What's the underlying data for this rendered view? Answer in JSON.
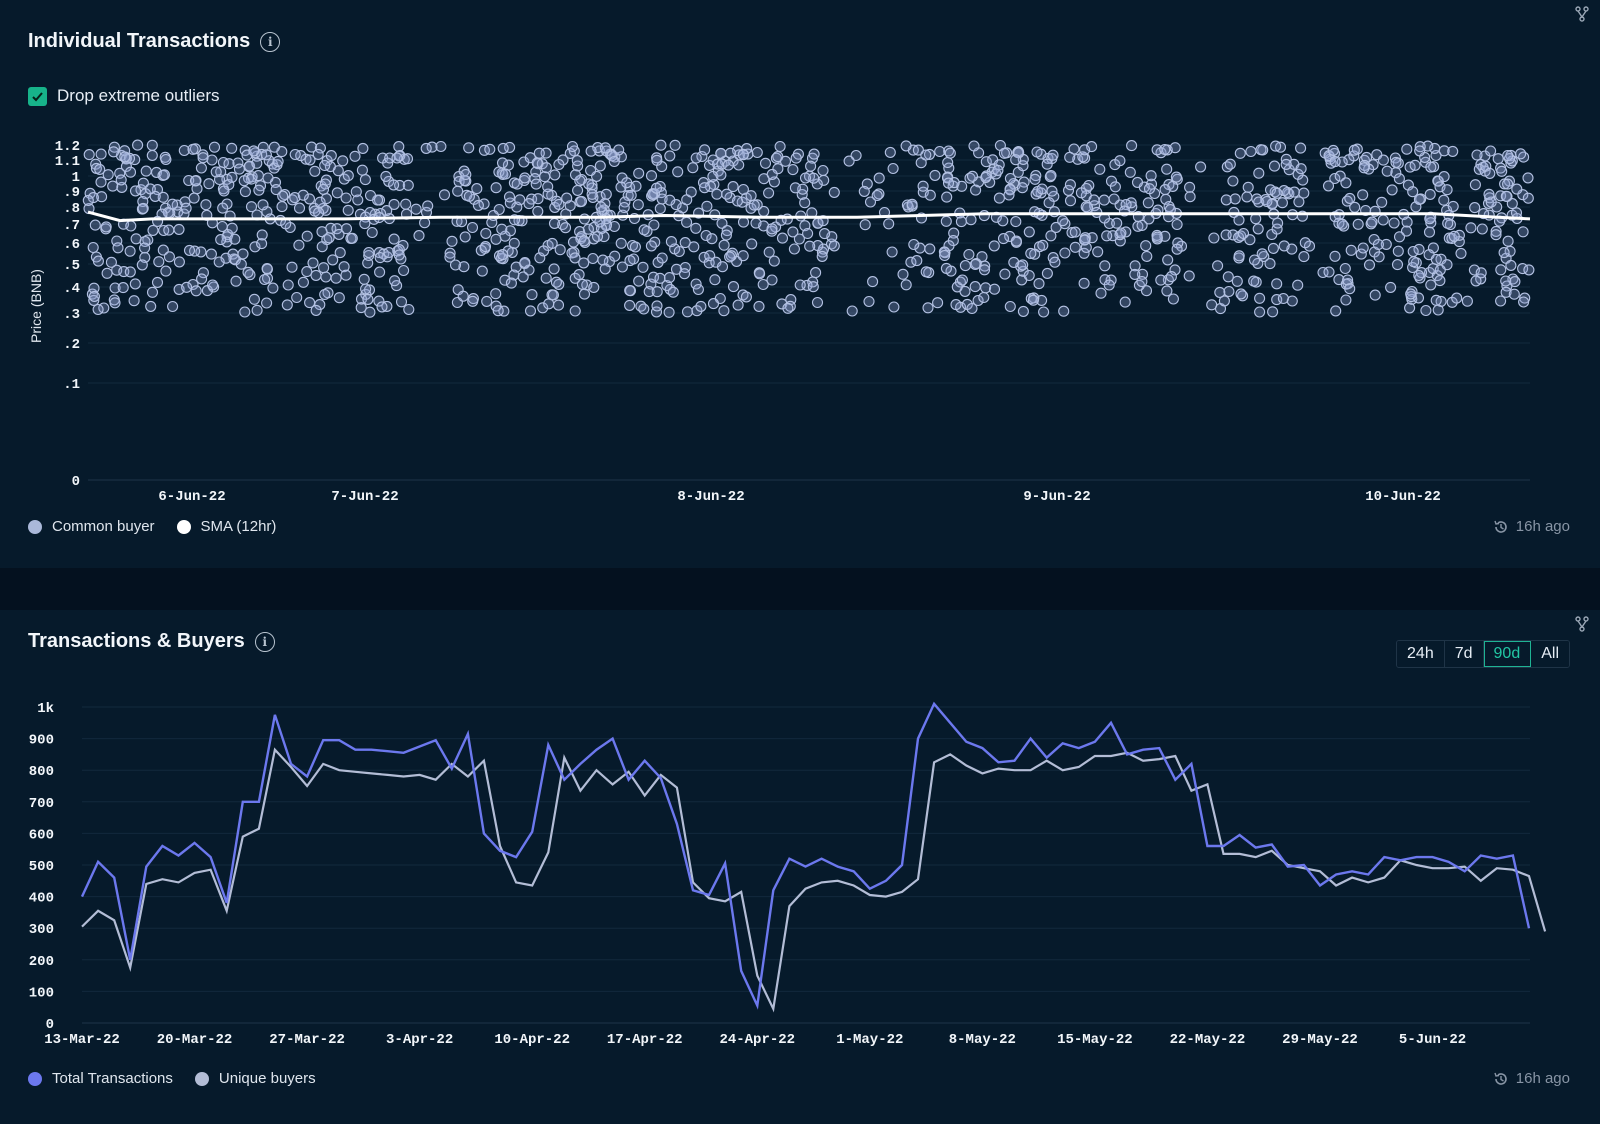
{
  "panel1": {
    "title": "Individual Transactions",
    "checkbox_label": "Drop extreme outliers",
    "checkbox_checked": true,
    "legend": [
      "Common buyer",
      "SMA (12hr)"
    ],
    "timestamp": "16h ago",
    "ylabel": "Price (BNB)"
  },
  "panel2": {
    "title": "Transactions & Buyers",
    "ranges": [
      "24h",
      "7d",
      "90d",
      "All"
    ],
    "active_range": "90d",
    "legend": [
      "Total Transactions",
      "Unique buyers"
    ],
    "timestamp": "16h ago"
  },
  "chart_data": [
    {
      "type": "scatter",
      "title": "Individual Transactions",
      "ylabel": "Price (BNB)",
      "y_ticks": [
        "0",
        ".1",
        ".2",
        ".3",
        ".4",
        ".5",
        ".6",
        ".7",
        ".8",
        ".9",
        "1",
        "1.1",
        "1.2"
      ],
      "x_ticks": [
        "6-Jun-22",
        "7-Jun-22",
        "8-Jun-22",
        "9-Jun-22",
        "10-Jun-22"
      ],
      "x_range_days": [
        5.4,
        9.9
      ],
      "y_range": [
        0.3,
        1.2
      ],
      "point_count_approx": 1400,
      "series": [
        {
          "name": "Common buyer",
          "color": "#aab8d9",
          "kind": "points"
        },
        {
          "name": "SMA (12hr)",
          "color": "#ffffff",
          "kind": "line",
          "x": [
            5.4,
            5.5,
            5.6,
            5.8,
            6.0,
            6.2,
            6.5,
            6.8,
            7.0,
            7.2,
            7.5,
            7.8,
            8.0,
            8.2,
            8.5,
            8.8,
            9.0,
            9.3,
            9.6,
            9.8,
            9.9
          ],
          "y": [
            0.77,
            0.72,
            0.73,
            0.73,
            0.73,
            0.73,
            0.74,
            0.74,
            0.74,
            0.75,
            0.74,
            0.74,
            0.75,
            0.76,
            0.76,
            0.76,
            0.76,
            0.76,
            0.76,
            0.74,
            0.73
          ]
        }
      ]
    },
    {
      "type": "line",
      "title": "Transactions & Buyers",
      "y_ticks": [
        "0",
        "100",
        "200",
        "300",
        "400",
        "500",
        "600",
        "700",
        "800",
        "900",
        "1k"
      ],
      "ylim": [
        0,
        1000
      ],
      "x_ticks": [
        "13-Mar-22",
        "20-Mar-22",
        "27-Mar-22",
        "3-Apr-22",
        "10-Apr-22",
        "17-Apr-22",
        "24-Apr-22",
        "1-May-22",
        "8-May-22",
        "15-May-22",
        "22-May-22",
        "29-May-22",
        "5-Jun-22"
      ],
      "x_start": "13-Mar-22",
      "series": [
        {
          "name": "Total Transactions",
          "color": "#6c78ee",
          "values": [
            400,
            510,
            460,
            200,
            495,
            560,
            530,
            570,
            525,
            380,
            700,
            700,
            975,
            820,
            780,
            895,
            895,
            865,
            865,
            860,
            855,
            875,
            895,
            805,
            915,
            600,
            545,
            525,
            605,
            880,
            770,
            820,
            865,
            900,
            770,
            830,
            775,
            630,
            420,
            405,
            505,
            165,
            55,
            420,
            520,
            495,
            520,
            495,
            480,
            425,
            450,
            500,
            900,
            1010,
            950,
            890,
            870,
            825,
            830,
            900,
            840,
            885,
            870,
            890,
            950,
            850,
            865,
            870,
            770,
            820,
            560,
            560,
            595,
            555,
            565,
            495,
            500,
            435,
            470,
            480,
            470,
            525,
            515,
            525,
            525,
            510,
            480,
            530,
            520,
            530,
            300
          ]
        },
        {
          "name": "Unique buyers",
          "color": "#b3bdd6",
          "values": [
            305,
            355,
            325,
            175,
            440,
            455,
            445,
            475,
            485,
            355,
            590,
            615,
            865,
            810,
            750,
            820,
            800,
            795,
            790,
            785,
            780,
            785,
            770,
            820,
            780,
            830,
            560,
            445,
            435,
            540,
            840,
            735,
            800,
            755,
            795,
            720,
            785,
            745,
            445,
            395,
            385,
            415,
            150,
            45,
            370,
            425,
            445,
            450,
            435,
            405,
            400,
            415,
            455,
            825,
            850,
            815,
            790,
            805,
            800,
            800,
            830,
            800,
            810,
            845,
            845,
            855,
            830,
            835,
            845,
            735,
            755,
            535,
            535,
            525,
            545,
            500,
            490,
            480,
            435,
            460,
            445,
            460,
            515,
            500,
            490,
            490,
            495,
            450,
            490,
            485,
            465,
            290
          ]
        }
      ]
    }
  ]
}
